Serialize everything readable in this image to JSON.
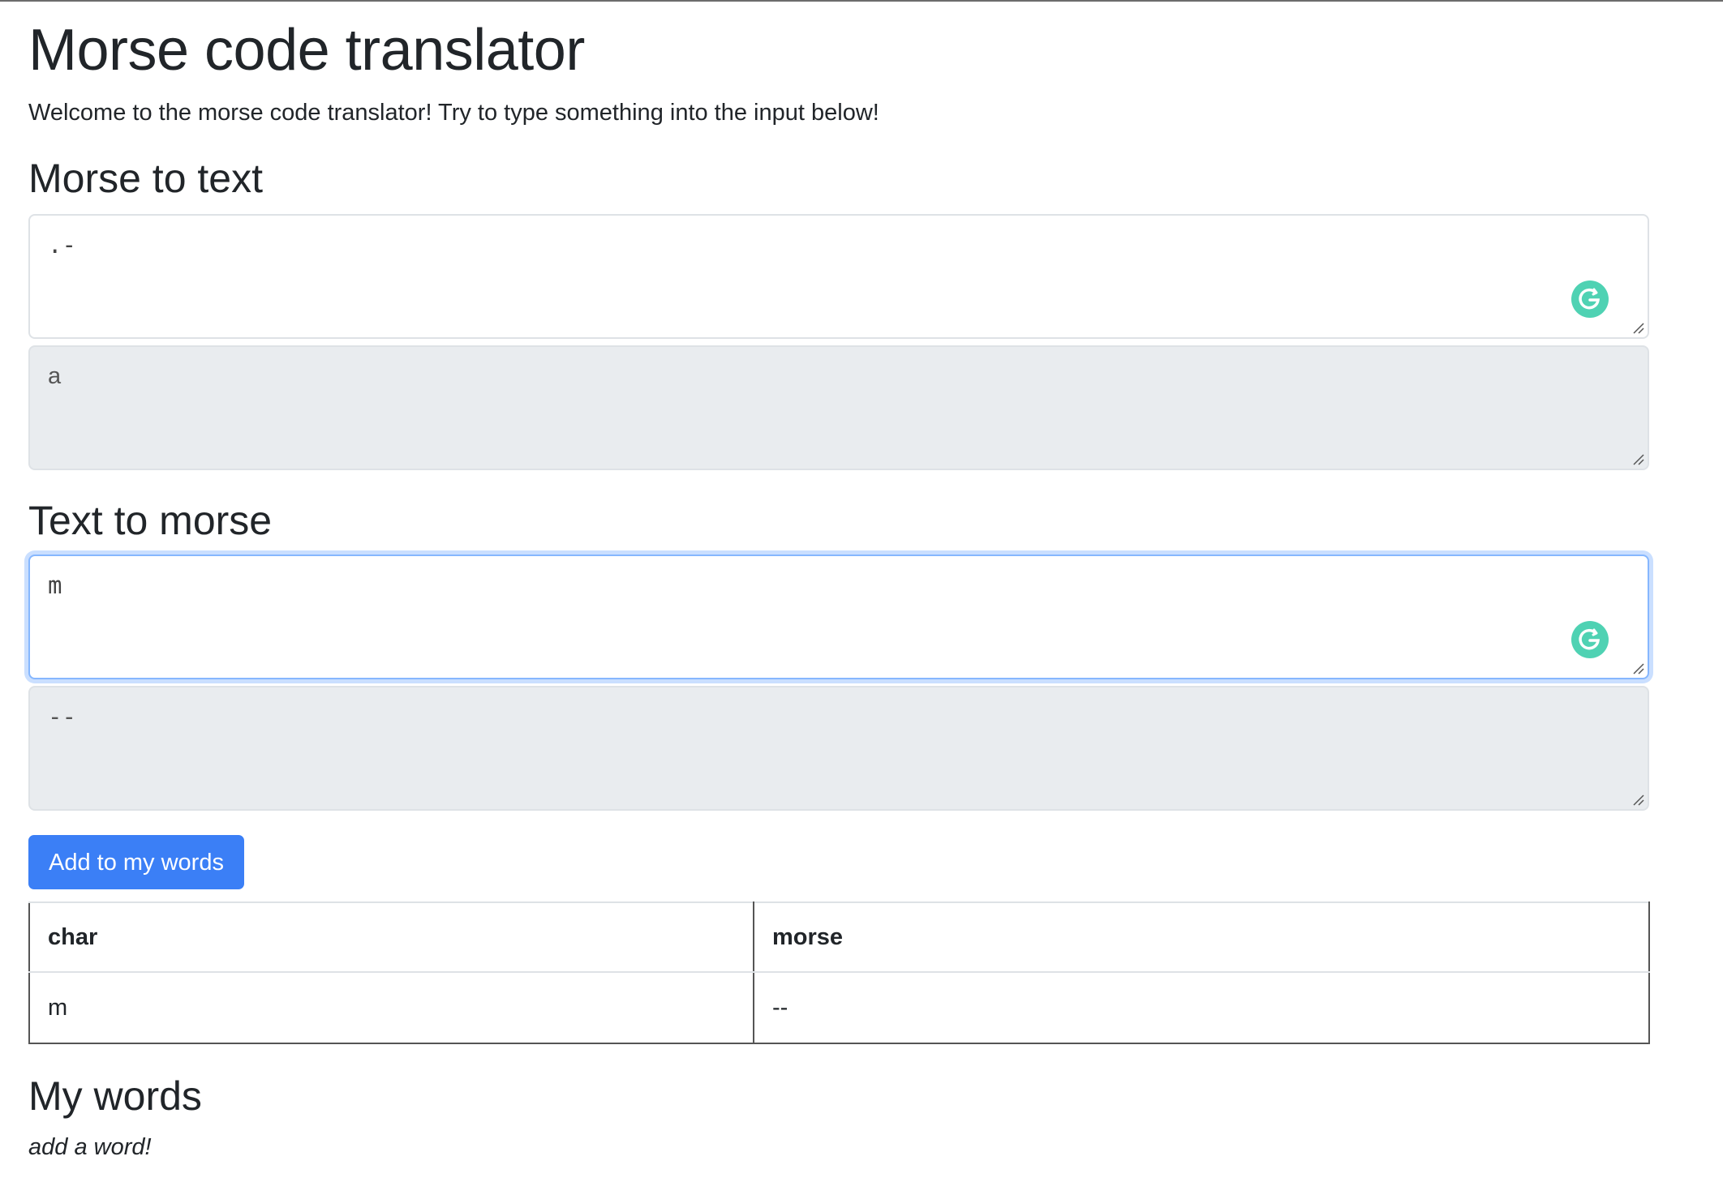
{
  "page": {
    "title": "Morse code translator",
    "intro": "Welcome to the morse code translator! Try to type something into the input below!"
  },
  "morse_to_text": {
    "heading": "Morse to text",
    "input_value": ".-",
    "output_value": "a"
  },
  "text_to_morse": {
    "heading": "Text to morse",
    "input_value": "m",
    "output_value": "--"
  },
  "add_button": {
    "label": "Add to my words"
  },
  "table": {
    "headers": [
      "char",
      "morse"
    ],
    "rows": [
      [
        "m",
        "--"
      ]
    ]
  },
  "my_words": {
    "heading": "My words",
    "empty_text": "add a word!"
  },
  "icons": {
    "grammar_assistant": "grammarly-g-icon",
    "resize": "resize-grip-icon"
  },
  "colors": {
    "primary": "#3b7ff6",
    "readonly_bg": "#e9ecef",
    "focus_ring": "#86b7fe",
    "grammar_icon": "#15c39a"
  }
}
